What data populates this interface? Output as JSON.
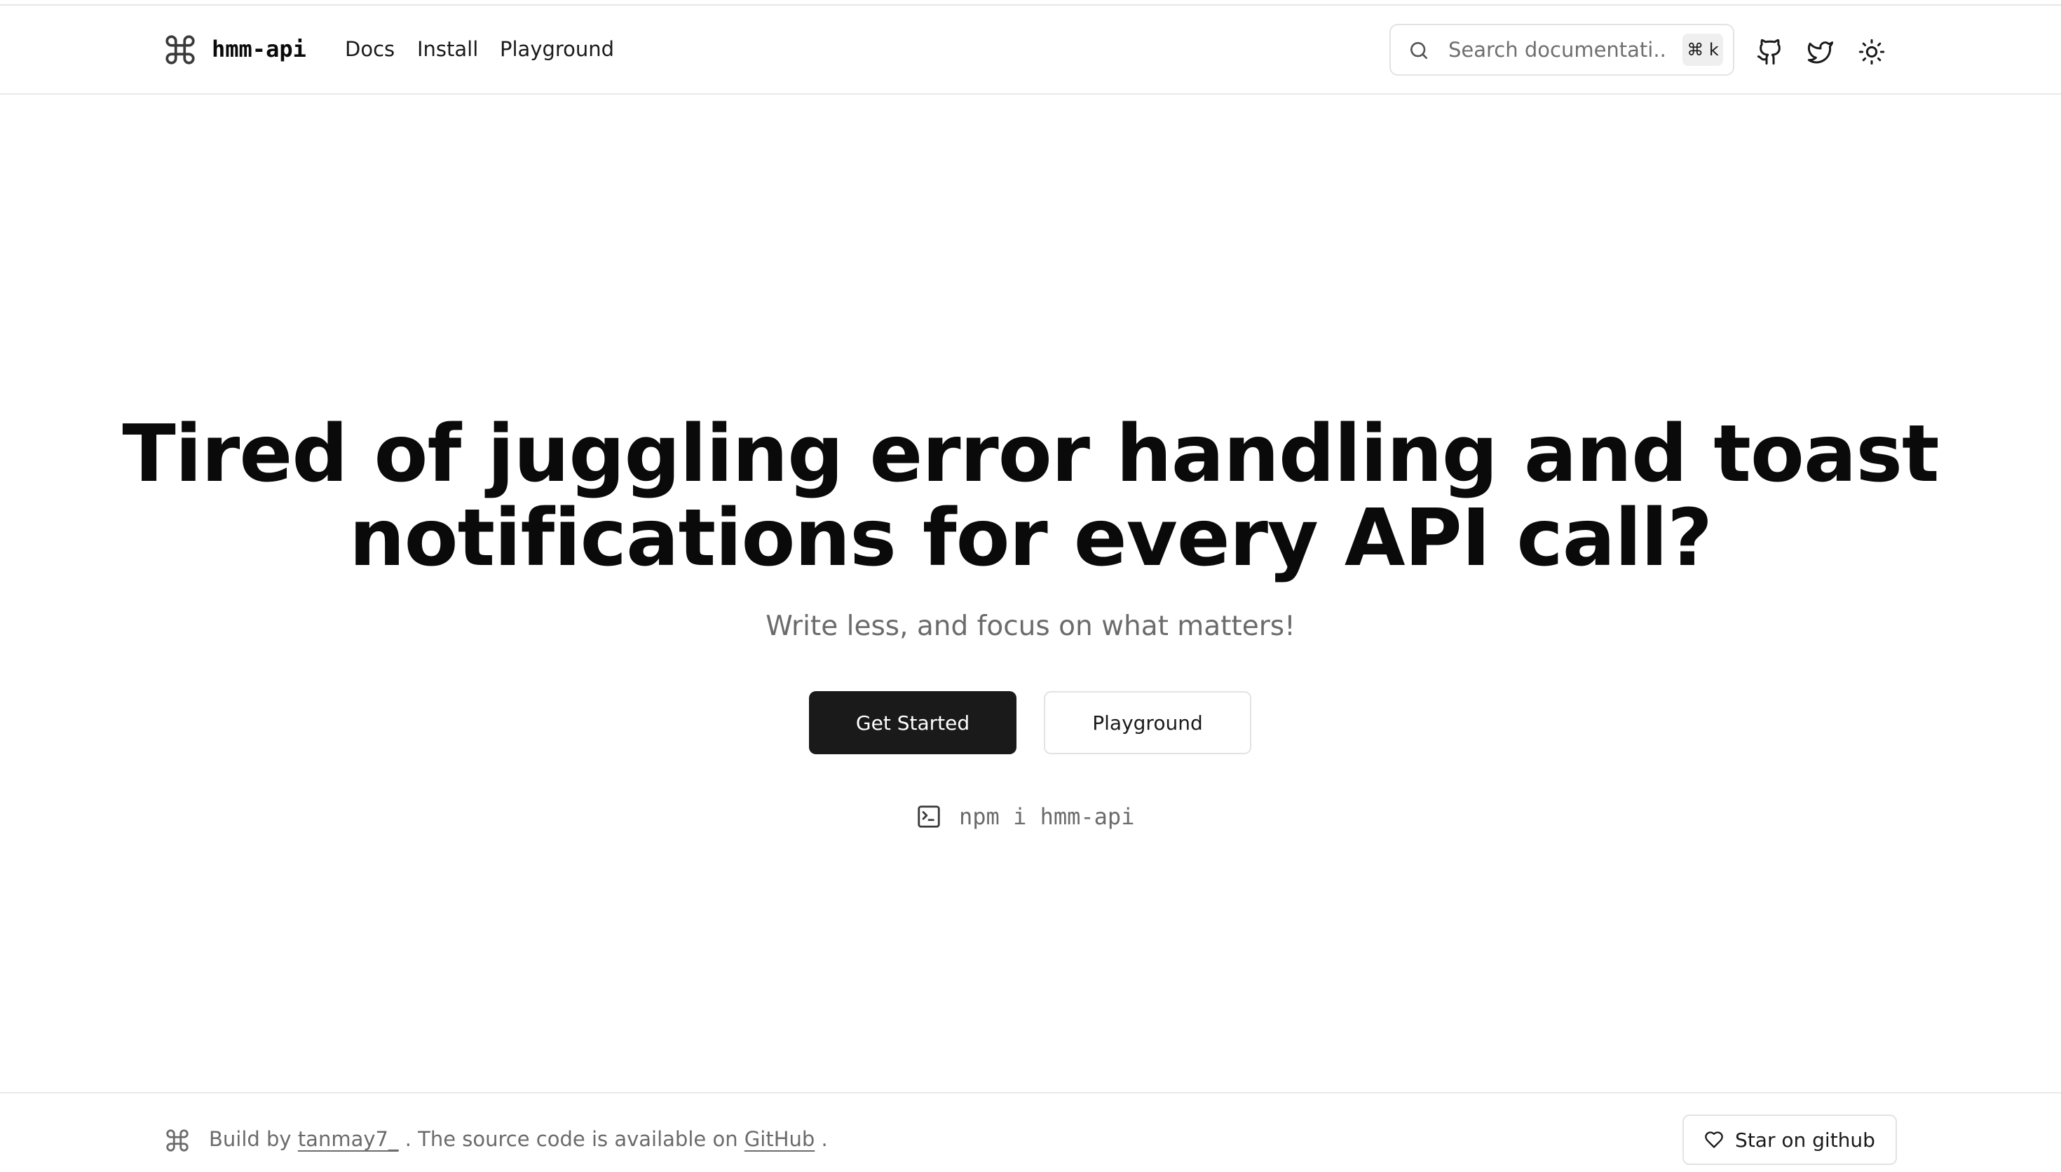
{
  "brand": {
    "name": "hmm-api",
    "logo_icon": "command-icon"
  },
  "nav": {
    "items": [
      {
        "label": "Docs"
      },
      {
        "label": "Install"
      },
      {
        "label": "Playground"
      }
    ]
  },
  "search": {
    "placeholder": "Search documentati...",
    "shortcut": "⌘ k"
  },
  "header_icons": [
    "github-icon",
    "twitter-icon",
    "sun-icon"
  ],
  "hero": {
    "title_line1": "Tired of juggling error handling and toast",
    "title_line2": "notifications for every API call?",
    "subtitle": "Write less, and focus on what matters!",
    "primary_button": "Get Started",
    "secondary_button": "Playground",
    "install_command": "npm i hmm-api"
  },
  "footer": {
    "prefix": "Build by",
    "author": "tanmay7_",
    "middle": ". The source code is available on",
    "repo_link": "GitHub",
    "suffix": ".",
    "star_button": "Star on github"
  },
  "colors": {
    "text": "#0a0a0a",
    "muted": "#6b6b6b",
    "primary_button_bg": "#1a1a1a",
    "border": "#e3e3e3"
  }
}
